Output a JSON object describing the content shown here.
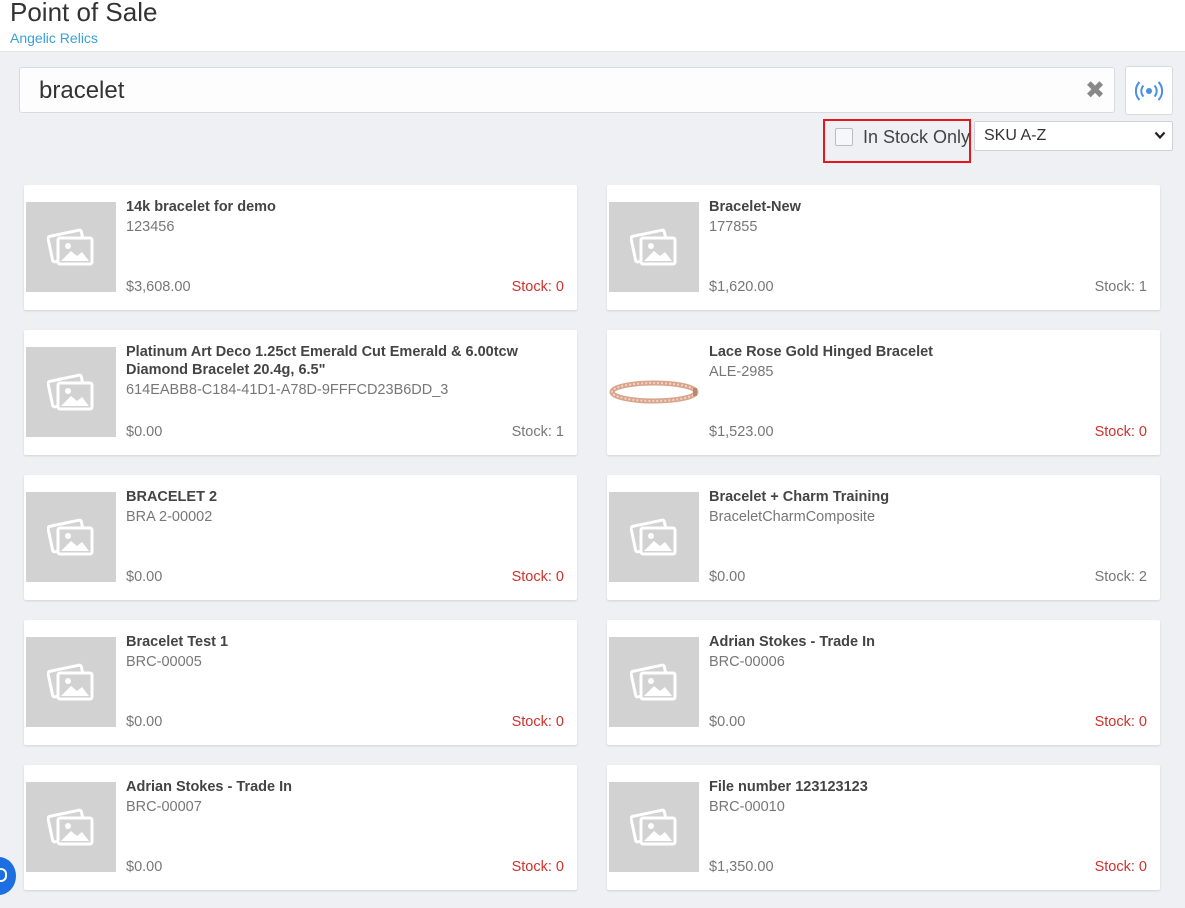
{
  "header": {
    "title": "Point of Sale",
    "store": "Angelic Relics"
  },
  "search": {
    "value": "bracelet",
    "clear_icon": "close-icon",
    "rfid_icon": "rfid-scan-icon"
  },
  "filters": {
    "in_stock_only_label": "In Stock Only",
    "in_stock_only_checked": false,
    "sort_selected": "SKU A-Z"
  },
  "colors": {
    "accent": "#3aa0dc",
    "stock_zero": "#d0312d",
    "highlight_box": "#e8161b"
  },
  "products": [
    {
      "name": "14k bracelet for demo",
      "sku": "123456",
      "price": "$3,608.00",
      "stock": "Stock: 0",
      "stock_count": 0,
      "image": "placeholder-image-icon"
    },
    {
      "name": "Bracelet-New",
      "sku": "177855",
      "price": "$1,620.00",
      "stock": "Stock: 1",
      "stock_count": 1,
      "image": "placeholder-image-icon"
    },
    {
      "name": "Platinum Art Deco 1.25ct Emerald Cut Emerald & 6.00tcw Diamond Bracelet 20.4g, 6.5\"",
      "sku": "614EABB8-C184-41D1-A78D-9FFFCD23B6DD_3",
      "price": "$0.00",
      "stock": "Stock: 1",
      "stock_count": 1,
      "image": "placeholder-image-icon"
    },
    {
      "name": "Lace Rose Gold Hinged Bracelet",
      "sku": "ALE-2985",
      "price": "$1,523.00",
      "stock": "Stock: 0",
      "stock_count": 0,
      "image": "bracelet-photo"
    },
    {
      "name": "BRACELET 2",
      "sku": "BRA 2-00002",
      "price": "$0.00",
      "stock": "Stock: 0",
      "stock_count": 0,
      "image": "placeholder-image-icon"
    },
    {
      "name": "Bracelet + Charm Training",
      "sku": "BraceletCharmComposite",
      "price": "$0.00",
      "stock": "Stock: 2",
      "stock_count": 2,
      "image": "placeholder-image-icon"
    },
    {
      "name": "Bracelet Test 1",
      "sku": "BRC-00005",
      "price": "$0.00",
      "stock": "Stock: 0",
      "stock_count": 0,
      "image": "placeholder-image-icon"
    },
    {
      "name": "Adrian Stokes - Trade In",
      "sku": "BRC-00006",
      "price": "$0.00",
      "stock": "Stock: 0",
      "stock_count": 0,
      "image": "placeholder-image-icon"
    },
    {
      "name": "Adrian Stokes - Trade In",
      "sku": "BRC-00007",
      "price": "$0.00",
      "stock": "Stock: 0",
      "stock_count": 0,
      "image": "placeholder-image-icon"
    },
    {
      "name": "File number 123123123",
      "sku": "BRC-00010",
      "price": "$1,350.00",
      "stock": "Stock: 0",
      "stock_count": 0,
      "image": "placeholder-image-icon"
    }
  ]
}
